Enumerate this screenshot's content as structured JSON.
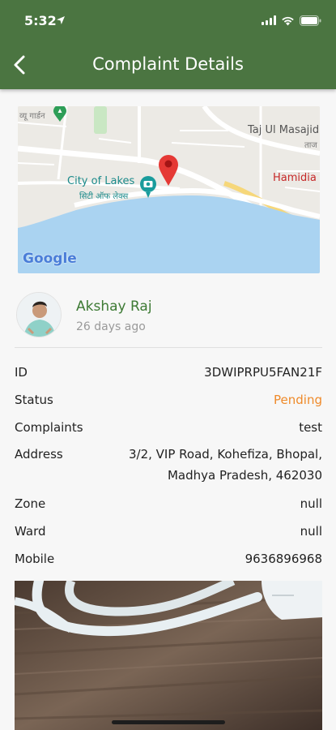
{
  "status_bar": {
    "time": "5:32"
  },
  "header": {
    "title": "Complaint Details"
  },
  "map": {
    "labels": {
      "top_left_fragment": "व्यू गार्डन",
      "mosque": "Taj Ul Masajid",
      "mosque_hindi": "ताज",
      "city": "City of Lakes",
      "city_hindi": "सिटी ऑफ लेक्स",
      "area": "Hamidia",
      "google": "Google"
    }
  },
  "user": {
    "name": "Akshay Raj",
    "time_ago": "26 days ago"
  },
  "details": {
    "id_label": "ID",
    "id_value": "3DWIPRPU5FAN21F",
    "status_label": "Status",
    "status_value": "Pending",
    "complaints_label": "Complaints",
    "complaints_value": "test",
    "address_label": "Address",
    "address_line1": "3/2, VIP Road, Kohefiza, Bhopal,",
    "address_line2": "Madhya Pradesh, 462030",
    "zone_label": "Zone",
    "zone_value": "null",
    "ward_label": "Ward",
    "ward_value": "null",
    "mobile_label": "Mobile",
    "mobile_value": "9636896968"
  },
  "colors": {
    "header": "#4b7541",
    "user_name": "#3d7a34",
    "pending": "#ef8a2a",
    "map_water": "#aad3f1",
    "map_pin": "#e53935"
  }
}
